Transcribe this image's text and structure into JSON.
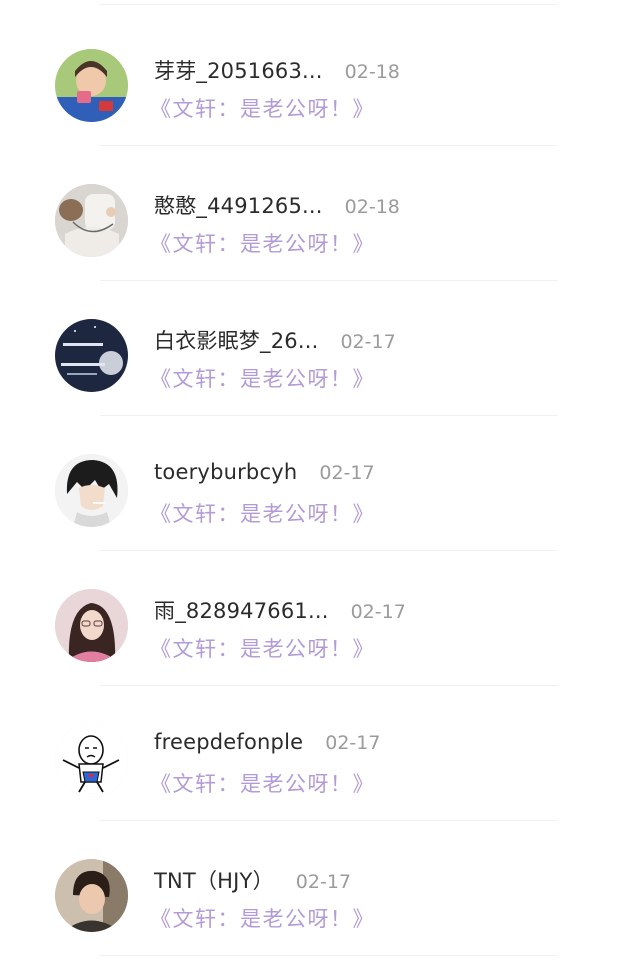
{
  "items": [
    {
      "name": "芽芽_2051663...",
      "date": "02-18",
      "message": "《文轩：是老公呀！》",
      "avatar": "avatar-boy-photo"
    },
    {
      "name": "憨憨_4491265...",
      "date": "02-18",
      "message": "《文轩：是老公呀！》",
      "avatar": "avatar-hands-photo"
    },
    {
      "name": "白衣影眠梦_26...",
      "date": "02-17",
      "message": "《文轩：是老公呀！》",
      "avatar": "avatar-night-moon"
    },
    {
      "name": "toeryburbcyh",
      "date": "02-17",
      "message": "《文轩：是老公呀！》",
      "avatar": "avatar-anime-boy"
    },
    {
      "name": "雨_828947661...",
      "date": "02-17",
      "message": "《文轩：是老公呀！》",
      "avatar": "avatar-girl-photo"
    },
    {
      "name": "freepdefonple",
      "date": "02-17",
      "message": "《文轩：是老公呀！》",
      "avatar": "avatar-cartoon-meme"
    },
    {
      "name": "TNT（HJY）",
      "date": "02-17",
      "message": "《文轩：是老公呀！》",
      "avatar": "avatar-boy-selfie"
    }
  ]
}
